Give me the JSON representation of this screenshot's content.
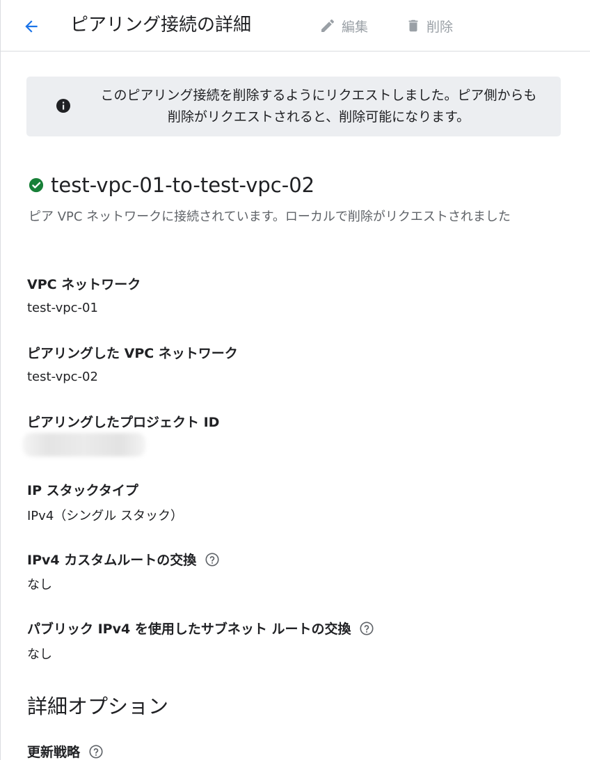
{
  "header": {
    "title": "ピアリング接続の詳細",
    "edit_label": "編集",
    "delete_label": "削除",
    "back_icon": "arrow-back-icon",
    "edit_icon": "pencil-icon",
    "delete_icon": "trash-icon"
  },
  "banner": {
    "icon": "info-icon",
    "text": "このピアリング接続を削除するようにリクエストしました。ピア側からも削除がリクエストされると、削除可能になります。"
  },
  "connection": {
    "name": "test-vpc-01-to-test-vpc-02",
    "status_icon": "check-circle-icon",
    "status_color": "#188038",
    "description": "ピア VPC ネットワークに接続されています。ローカルで削除がリクエストされました"
  },
  "fields": {
    "vpc_network": {
      "label": "VPC ネットワーク",
      "value": "test-vpc-01"
    },
    "peered_vpc_network": {
      "label": "ピアリングした VPC ネットワーク",
      "value": "test-vpc-02"
    },
    "peered_project_id": {
      "label": "ピアリングしたプロジェクト ID"
    },
    "ip_stack_type": {
      "label": "IP スタックタイプ",
      "value": "IPv4（シングル スタック）"
    },
    "ipv4_custom_routes": {
      "label": "IPv4 カスタムルートの交換",
      "value": "なし"
    },
    "public_ipv4_subnet_routes": {
      "label": "パブリック IPv4 を使用したサブネット ルートの交換",
      "value": "なし"
    }
  },
  "advanced": {
    "section_title": "詳細オプション",
    "update_strategy_label": "更新戦略"
  },
  "colors": {
    "accent": "#1a73e8",
    "disabled": "#9aa0a6",
    "banner_bg": "#eceef1",
    "success": "#188038"
  }
}
